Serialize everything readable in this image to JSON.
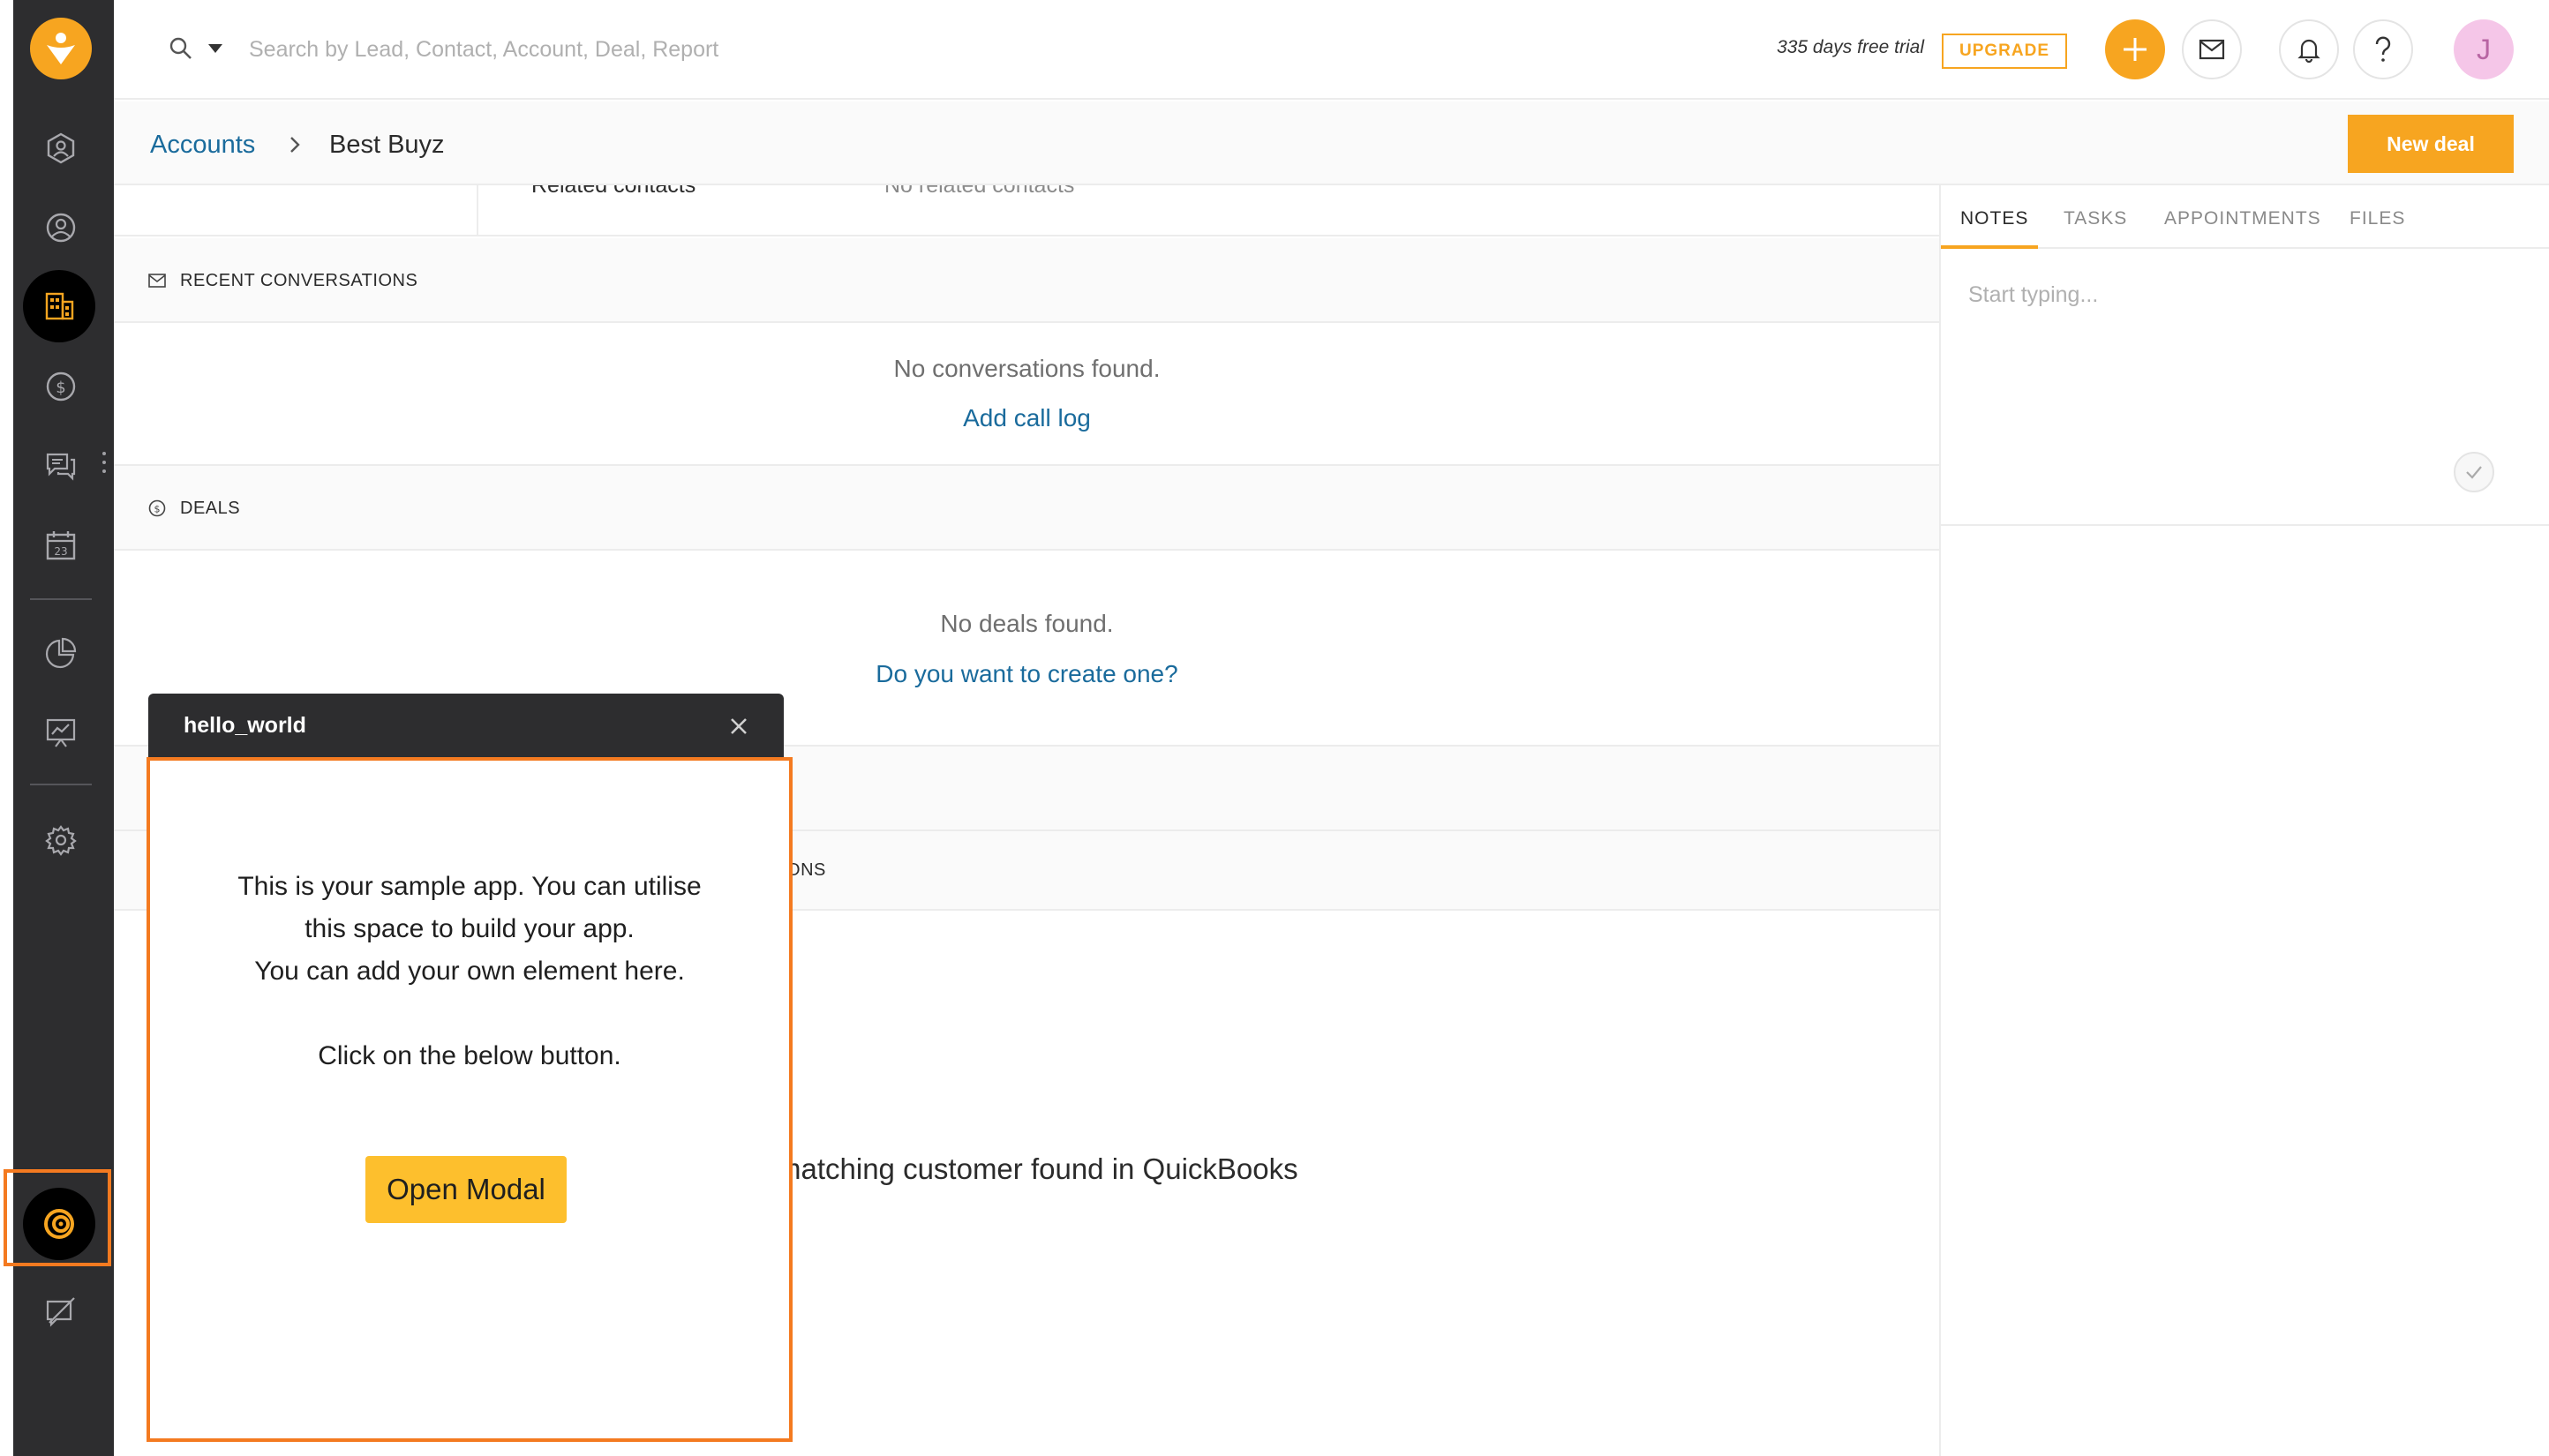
{
  "topbar": {
    "search_placeholder": "Search by Lead, Contact, Account, Deal, Report",
    "trial_text": "335 days free trial",
    "upgrade_label": "UPGRADE",
    "avatar_initial": "J"
  },
  "breadcrumb": {
    "parent": "Accounts",
    "current": "Best Buyz",
    "new_deal_label": "New deal"
  },
  "main": {
    "related_contacts_label": "Related contacts",
    "related_contacts_value": "No related contacts",
    "recent_conversations": {
      "title": "RECENT CONVERSATIONS",
      "empty": "No conversations found.",
      "action": "Add call log"
    },
    "deals": {
      "title": "DEALS",
      "empty": "No deals found.",
      "action": "Do you want to create one?"
    },
    "integration_tail": "IONS",
    "quickbooks_text": "matching customer found in QuickBooks"
  },
  "right_panel": {
    "tabs": [
      "NOTES",
      "TASKS",
      "APPOINTMENTS",
      "FILES"
    ],
    "active_tab": "NOTES",
    "notes_placeholder": "Start typing..."
  },
  "widget": {
    "title": "hello_world",
    "line1": "This is your sample app. You can utilise",
    "line2": "this space to build your app.",
    "line3": "You can add your own element here.",
    "line4": "Click on the below button.",
    "button_label": "Open Modal"
  },
  "colors": {
    "accent": "#f7a520",
    "link": "#1a6b9c",
    "rail": "#2d2d2f",
    "highlight": "#f47a20"
  }
}
